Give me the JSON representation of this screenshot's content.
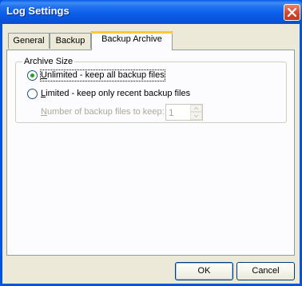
{
  "window": {
    "title": "Log Settings"
  },
  "tabs": [
    {
      "label": "General",
      "active": false
    },
    {
      "label": "Backup",
      "active": false
    },
    {
      "label": "Backup Archive",
      "active": true
    }
  ],
  "archive_size": {
    "group_label": "Archive Size",
    "option_unlimited": {
      "mnemonic": "U",
      "rest": "nlimited - keep all backup files",
      "checked": true
    },
    "option_limited": {
      "mnemonic": "L",
      "rest": "imited - keep only recent backup files",
      "checked": false
    },
    "count_label": {
      "mnemonic": "N",
      "rest": "umber of backup files to keep:"
    },
    "count_value": "1"
  },
  "buttons": {
    "ok": "OK",
    "cancel": "Cancel"
  },
  "colors": {
    "titlebar": "#0a5ce8",
    "dialog_bg": "#ece9d8",
    "panel_bg": "#fcfcfe",
    "tab_highlight": "#ffc83c",
    "radio_dot": "#21a121",
    "disabled_text": "#aca899"
  }
}
